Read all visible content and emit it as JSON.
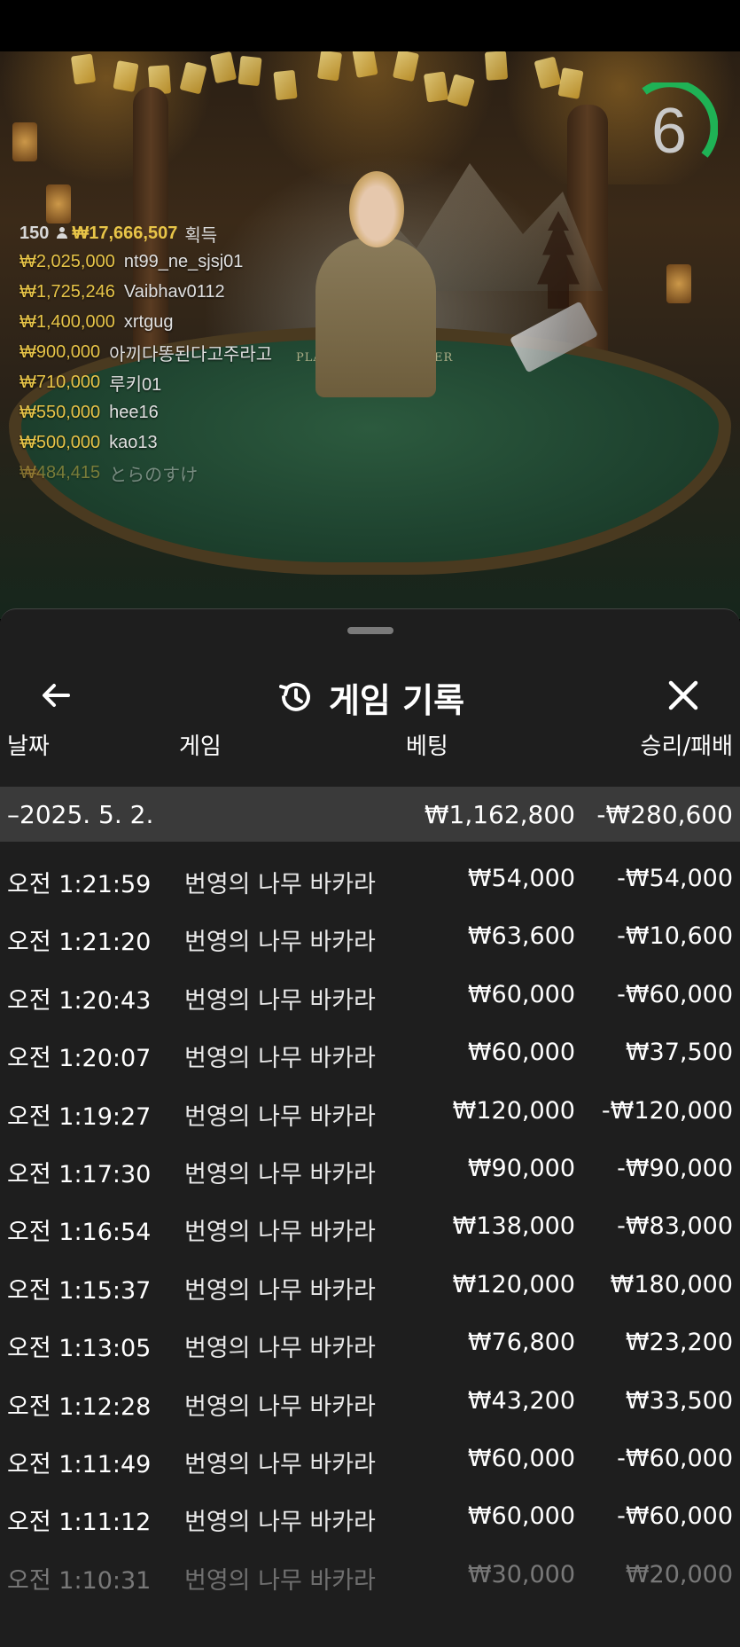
{
  "live": {
    "timer": "6",
    "winners": {
      "count": "150",
      "total": "₩17,666,507",
      "won_label": "획득",
      "list": [
        {
          "amount": "₩2,025,000",
          "nick": "nt99_ne_sjsj01"
        },
        {
          "amount": "₩1,725,246",
          "nick": "Vaibhav0112"
        },
        {
          "amount": "₩1,400,000",
          "nick": "xrtgug"
        },
        {
          "amount": "₩900,000",
          "nick": "아끼다똥된다고주라고"
        },
        {
          "amount": "₩710,000",
          "nick": "루키01"
        },
        {
          "amount": "₩550,000",
          "nick": "hee16"
        },
        {
          "amount": "₩500,000",
          "nick": "kao13"
        },
        {
          "amount": "₩484,415",
          "nick": "とらのすけ"
        }
      ]
    },
    "table_labels": {
      "player": "PLAYER",
      "banker": "BANKER"
    }
  },
  "colors": {
    "accent_gold": "#e8c548",
    "timer_green": "#1fb255",
    "sheet_bg": "#1e1e1e",
    "summary_bg": "#3a3a3a"
  },
  "sheet": {
    "title": "게임 기록",
    "icons": {
      "back": "arrow-left-icon",
      "history": "history-icon",
      "close": "close-icon"
    },
    "columns": {
      "date": "날짜",
      "game": "게임",
      "bet": "베팅",
      "result": "승리/패배"
    },
    "summary": {
      "date": "–2025. 5. 2.",
      "bet": "₩1,162,800",
      "result": "-₩280,600"
    },
    "rows": [
      {
        "time": "오전 1:21:59",
        "game": "번영의 나무 바카라",
        "bet": "₩54,000",
        "result": "-₩54,000"
      },
      {
        "time": "오전 1:21:20",
        "game": "번영의 나무 바카라",
        "bet": "₩63,600",
        "result": "-₩10,600"
      },
      {
        "time": "오전 1:20:43",
        "game": "번영의 나무 바카라",
        "bet": "₩60,000",
        "result": "-₩60,000"
      },
      {
        "time": "오전 1:20:07",
        "game": "번영의 나무 바카라",
        "bet": "₩60,000",
        "result": "₩37,500"
      },
      {
        "time": "오전 1:19:27",
        "game": "번영의 나무 바카라",
        "bet": "₩120,000",
        "result": "-₩120,000"
      },
      {
        "time": "오전 1:17:30",
        "game": "번영의 나무 바카라",
        "bet": "₩90,000",
        "result": "-₩90,000"
      },
      {
        "time": "오전 1:16:54",
        "game": "번영의 나무 바카라",
        "bet": "₩138,000",
        "result": "-₩83,000"
      },
      {
        "time": "오전 1:15:37",
        "game": "번영의 나무 바카라",
        "bet": "₩120,000",
        "result": "₩180,000"
      },
      {
        "time": "오전 1:13:05",
        "game": "번영의 나무 바카라",
        "bet": "₩76,800",
        "result": "₩23,200"
      },
      {
        "time": "오전 1:12:28",
        "game": "번영의 나무 바카라",
        "bet": "₩43,200",
        "result": "₩33,500"
      },
      {
        "time": "오전 1:11:49",
        "game": "번영의 나무 바카라",
        "bet": "₩60,000",
        "result": "-₩60,000"
      },
      {
        "time": "오전 1:11:12",
        "game": "번영의 나무 바카라",
        "bet": "₩60,000",
        "result": "-₩60,000"
      },
      {
        "time": "오전 1:10:31",
        "game": "번영의 나무 바카라",
        "bet": "₩30,000",
        "result": "₩20,000"
      }
    ]
  }
}
